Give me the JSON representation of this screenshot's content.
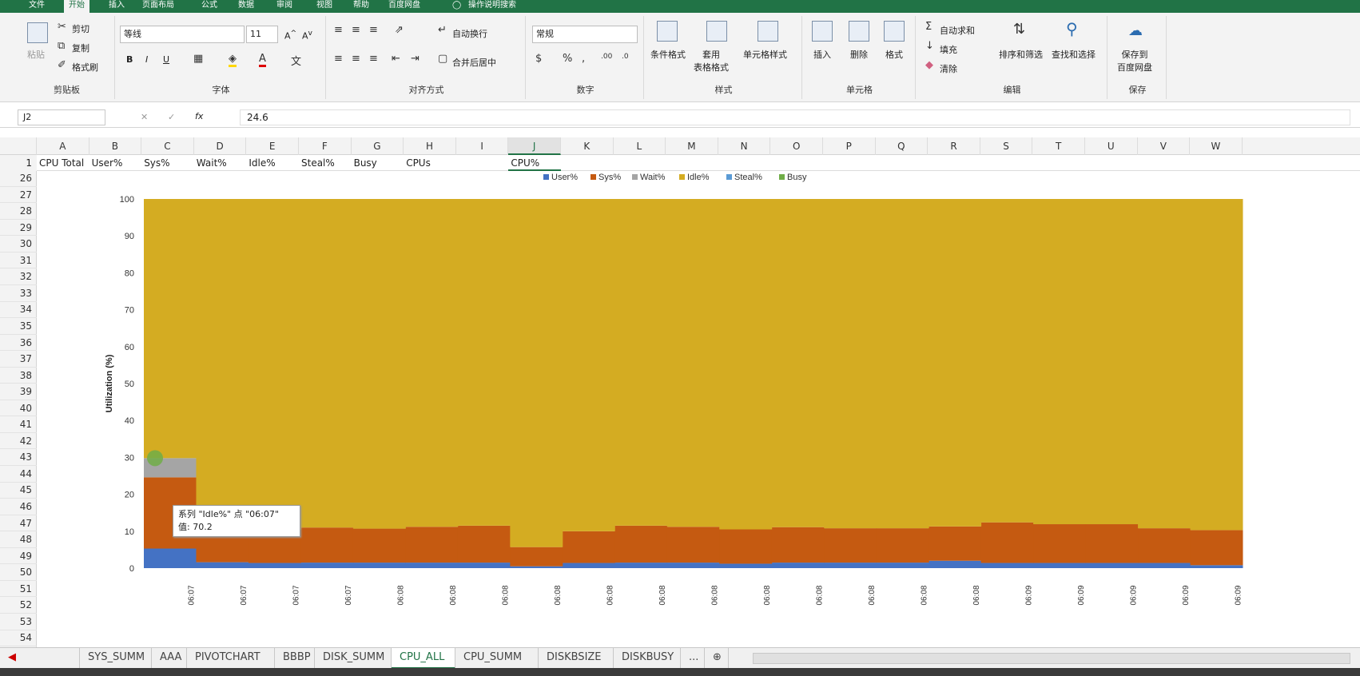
{
  "ribbon_tabs": [
    "文件",
    "开始",
    "插入",
    "页面布局",
    "公式",
    "数据",
    "审阅",
    "视图",
    "帮助",
    "百度网盘",
    "操作说明搜索"
  ],
  "active_tab": "开始",
  "clipboard": {
    "paste": "粘贴",
    "cut": "剪切",
    "copy": "复制",
    "format_painter": "格式刷",
    "label": "剪贴板"
  },
  "font": {
    "name": "等线",
    "size": "11",
    "label": "字体"
  },
  "alignment": {
    "wrap": "自动换行",
    "merge": "合并后居中",
    "label": "对齐方式"
  },
  "number": {
    "format": "常规",
    "label": "数字"
  },
  "styles": {
    "conditional": "条件格式",
    "table": "套用\n表格格式",
    "cell_styles": "单元格样式",
    "label": "样式"
  },
  "cells": {
    "insert": "插入",
    "delete": "删除",
    "format": "格式",
    "label": "单元格"
  },
  "editing": {
    "autosum": "自动求和",
    "fill": "填充",
    "clear": "清除",
    "sort": "排序和筛选",
    "find": "查找和选择",
    "label": "编辑"
  },
  "save": {
    "btn": "保存到\n百度网盘",
    "label": "保存"
  },
  "name_box": "J2",
  "formula_value": "24.6",
  "columns": [
    "A",
    "B",
    "C",
    "D",
    "E",
    "F",
    "G",
    "H",
    "I",
    "J",
    "K",
    "L",
    "M",
    "N",
    "O",
    "P",
    "Q",
    "R",
    "S",
    "T",
    "U",
    "V",
    "W"
  ],
  "row1": [
    "CPU Total",
    "User%",
    "Sys%",
    "Wait%",
    "Idle%",
    "Steal%",
    "Busy",
    "CPUs",
    "",
    "CPU%"
  ],
  "row_numbers": [
    "1",
    "26",
    "27",
    "28",
    "29",
    "30",
    "31",
    "32",
    "33",
    "34",
    "35",
    "36",
    "37",
    "38",
    "39",
    "40",
    "41",
    "42",
    "43",
    "44",
    "45",
    "46",
    "47",
    "48",
    "49",
    "50",
    "51",
    "52",
    "53",
    "54"
  ],
  "tooltip": {
    "line1": "系列 \"Idle%\" 点 \"06:07\"",
    "line2": "值: 70.2"
  },
  "sheet_tabs": [
    "SYS_SUMM",
    "AAA",
    "PIVOTCHART",
    "BBBP",
    "DISK_SUMM",
    "CPU_ALL",
    "CPU_SUMM",
    "DISKBSIZE",
    "DISKBUSY",
    "..."
  ],
  "active_sheet": "CPU_ALL",
  "chart_data": {
    "type": "area",
    "stacked": true,
    "ylabel": "Utilization (%)",
    "ylim": [
      0,
      100
    ],
    "yticks": [
      0,
      10,
      20,
      30,
      40,
      50,
      60,
      70,
      80,
      90,
      100
    ],
    "legend_position": "top",
    "x": [
      "06:07",
      "06:07",
      "06:07",
      "06:07",
      "06:08",
      "06:08",
      "06:08",
      "06:08",
      "06:08",
      "06:08",
      "06:08",
      "06:08",
      "06:08",
      "06:08",
      "06:08",
      "06:08",
      "06:09",
      "06:09",
      "06:09",
      "06:09",
      "06:09"
    ],
    "series": [
      {
        "name": "User%",
        "color": "#4472C4",
        "values": [
          5.3,
          1.6,
          1.4,
          1.5,
          1.5,
          1.5,
          1.5,
          0.5,
          1.4,
          1.5,
          1.5,
          1.2,
          1.5,
          1.5,
          1.5,
          2.0,
          1.4,
          1.4,
          1.4,
          1.4,
          0.8
        ]
      },
      {
        "name": "Sys%",
        "color": "#C55A11",
        "values": [
          19.3,
          9.0,
          9.0,
          9.5,
          9.2,
          9.7,
          10.0,
          5.2,
          8.6,
          10.0,
          9.7,
          9.3,
          9.6,
          9.3,
          9.3,
          9.3,
          11.0,
          10.5,
          10.5,
          9.4,
          9.5
        ]
      },
      {
        "name": "Wait%",
        "color": "#A5A5A5",
        "values": [
          5.2,
          0,
          0,
          0,
          0,
          0,
          0,
          0,
          0,
          0,
          0,
          0,
          0,
          0,
          0,
          0,
          0,
          0,
          0,
          0,
          0
        ]
      },
      {
        "name": "Idle%",
        "color": "#D4AC22",
        "values": [
          70.2,
          89.4,
          89.6,
          89.0,
          89.3,
          88.8,
          88.5,
          94.3,
          90.0,
          88.5,
          88.8,
          89.5,
          88.9,
          89.2,
          89.2,
          88.7,
          87.6,
          88.1,
          88.1,
          89.2,
          89.7
        ]
      },
      {
        "name": "Steal%",
        "color": "#5B9BD5",
        "values": [
          0,
          0,
          0,
          0,
          0,
          0,
          0,
          0,
          0,
          0,
          0,
          0,
          0,
          0,
          0,
          0,
          0,
          0,
          0,
          0,
          0
        ]
      },
      {
        "name": "Busy",
        "color": "#70AD47",
        "values": [
          0,
          0,
          0,
          0,
          0,
          0,
          0,
          0,
          0,
          0,
          0,
          0,
          0,
          0,
          0,
          0,
          0,
          0,
          0,
          0,
          0
        ]
      }
    ]
  }
}
